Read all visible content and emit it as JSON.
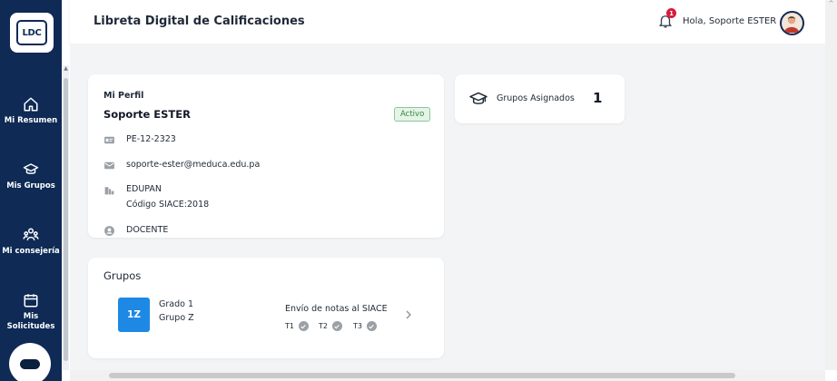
{
  "sidebar": {
    "logo_text": "LDC",
    "items": [
      {
        "label": "Mi Resumen",
        "icon": "home-icon"
      },
      {
        "label": "Mis Grupos",
        "icon": "graduation-cap-icon"
      },
      {
        "label": "Mi consejería",
        "icon": "people-icon"
      },
      {
        "label": "Mis Solicitudes",
        "icon": "calendar-icon"
      }
    ],
    "chat_icon": "chat-icon"
  },
  "header": {
    "title": "Libreta Digital de Calificaciones",
    "notification_count": "1",
    "greeting": "Hola, Soporte ESTER"
  },
  "profile": {
    "heading": "Mi Perfil",
    "name": "Soporte ESTER",
    "status": "Activo",
    "id_number": "PE-12-2323",
    "email": "soporte-ester@meduca.edu.pa",
    "school": "EDUPAN",
    "siace_code": "Código SIACE:2018",
    "role": "DOCENTE"
  },
  "assigned_groups": {
    "label": "Grupos Asignados",
    "count": "1"
  },
  "groups": {
    "title": "Grupos",
    "items": [
      {
        "tile": "1Z",
        "grade": "Grado 1",
        "group": "Grupo Z",
        "submission_label": "Envío de notas al SIACE",
        "terms": [
          "T1",
          "T2",
          "T3"
        ]
      }
    ]
  },
  "colors": {
    "sidebar": "#0e2a55",
    "accent": "#1e88e5",
    "status_active": "#2f8a3a",
    "badge": "#d81b3a"
  }
}
